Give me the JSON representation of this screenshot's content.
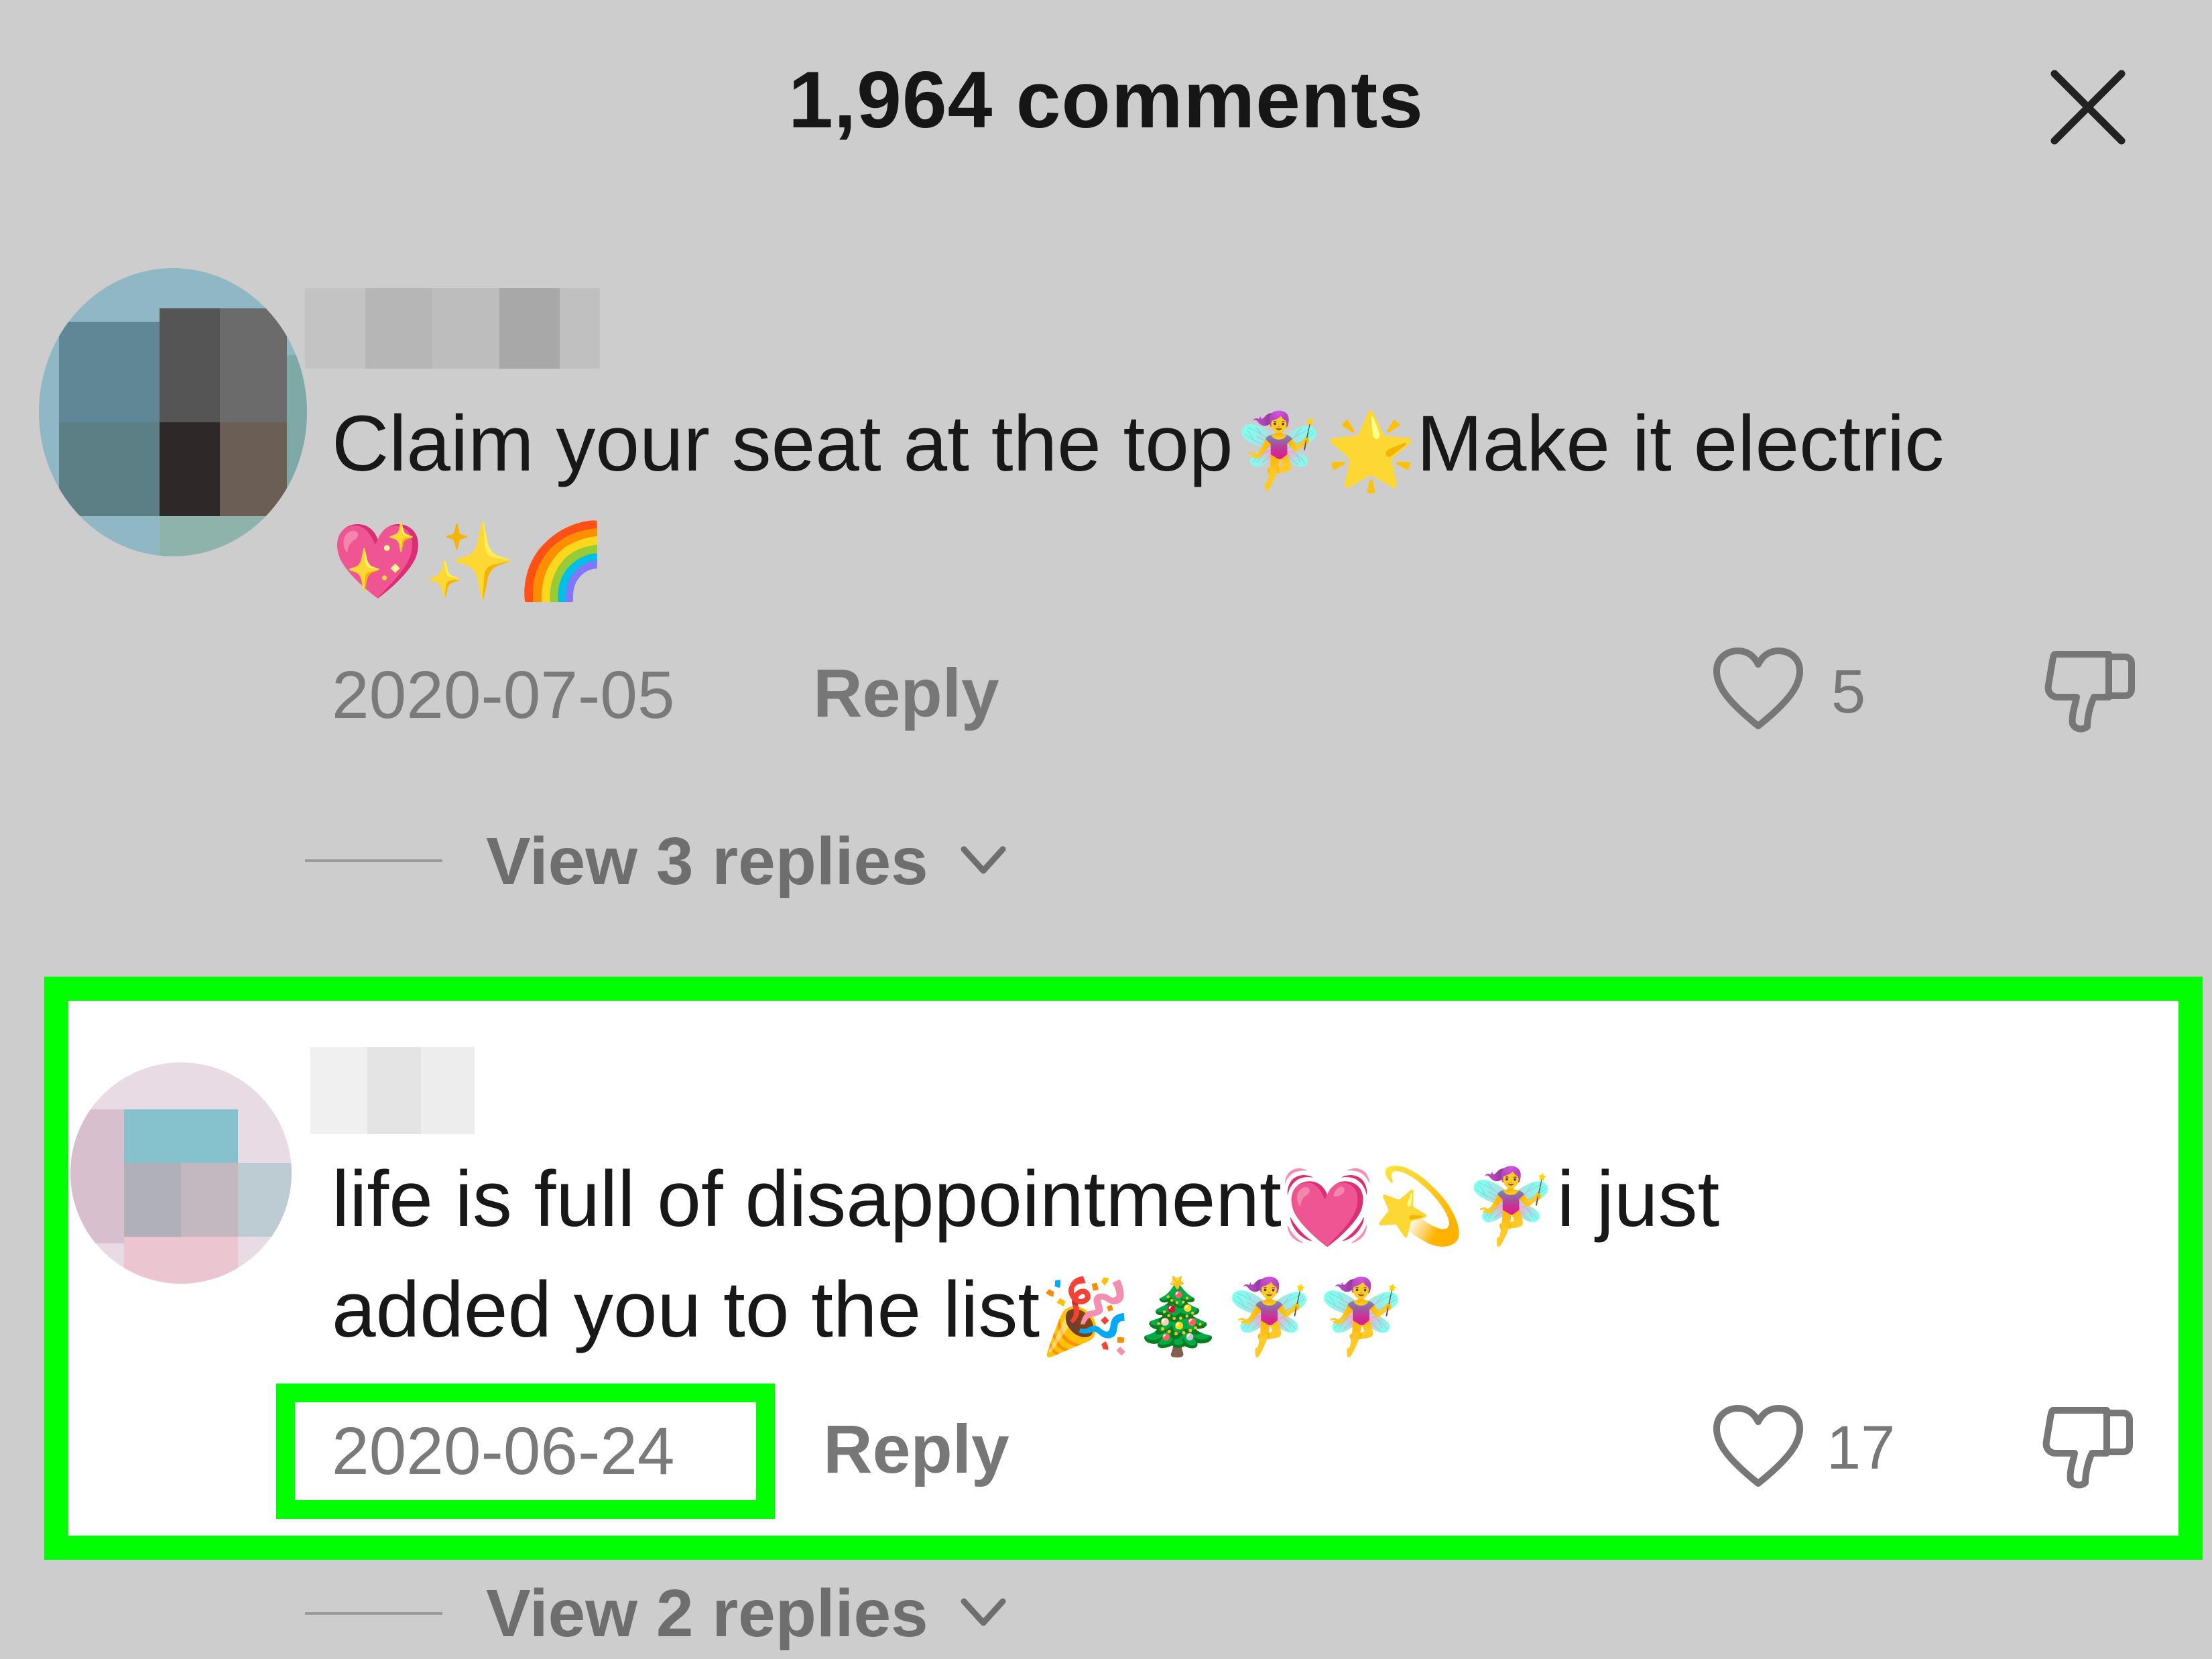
{
  "header": {
    "title": "1,964 comments",
    "close_icon": "close-icon"
  },
  "colors": {
    "highlight": "#00ff00",
    "background": "#cdcdcd",
    "panel": "#ffffff"
  },
  "comments": [
    {
      "text": "Claim your seat at the top",
      "emoji_a": "🧚‍♀️🌟",
      "text_b": "Make it electric",
      "emoji_line2": "💖✨🌈",
      "date": "2020-07-05",
      "reply_label": "Reply",
      "likes": "5",
      "view_replies": "View 3 replies"
    },
    {
      "text": "life is full of disappointment",
      "emoji_a": "💓💫🧚‍♀️",
      "text_b": "i just",
      "line2_text": "added you to the list",
      "emoji_line2": "🎉🎄🧚‍♀️🧚‍♀️",
      "date": "2020-06-24",
      "reply_label": "Reply",
      "likes": "17",
      "view_replies": "View 2 replies"
    }
  ]
}
